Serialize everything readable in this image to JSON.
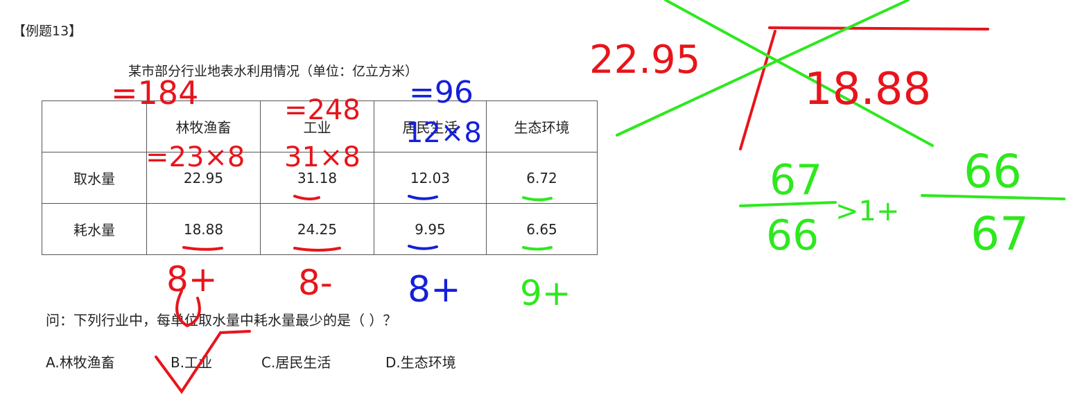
{
  "label": "【例题13】",
  "table_title": "某市部分行业地表水利用情况（单位：亿立方米）",
  "table": {
    "headers": [
      "",
      "林牧渔畜",
      "工业",
      "居民生活",
      "生态环境"
    ],
    "rows": [
      {
        "label": "取水量",
        "values": [
          "22.95",
          "31.18",
          "12.03",
          "6.72"
        ]
      },
      {
        "label": "耗水量",
        "values": [
          "18.88",
          "24.25",
          "9.95",
          "6.65"
        ]
      }
    ]
  },
  "question": "问：下列行业中，每单位取水量中耗水量最少的是（ ）？",
  "options": [
    "A.林牧渔畜",
    "B.工业",
    "C.居民生活",
    "D.生态环境"
  ],
  "annotations": {
    "red": [
      "=184",
      "=248",
      "=23×8",
      "31×8",
      "8+",
      "8-",
      "22.95",
      "18.88"
    ],
    "blue": [
      "=96",
      "12×8",
      "8+"
    ],
    "green": [
      "9+",
      "67",
      "66",
      ">1+",
      "66",
      "67"
    ]
  },
  "colors": {
    "red": "#e8141b",
    "blue": "#1420d8",
    "green": "#2ee81e"
  }
}
